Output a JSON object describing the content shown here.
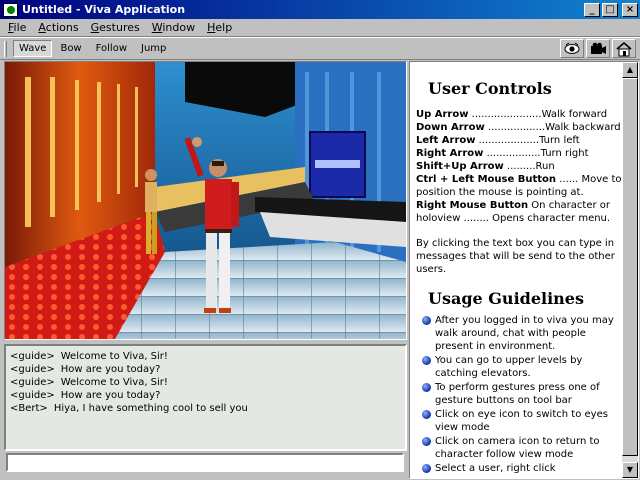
{
  "window": {
    "title": "Untitled - Viva Application",
    "minimize_label": "_",
    "maximize_label": "□",
    "close_label": "×"
  },
  "menu": [
    {
      "first": "F",
      "rest": "ile"
    },
    {
      "first": "A",
      "rest": "ctions"
    },
    {
      "first": "G",
      "rest": "estures"
    },
    {
      "first": "W",
      "rest": "indow"
    },
    {
      "first": "H",
      "rest": "elp"
    }
  ],
  "toolbar": {
    "gestures": [
      "Wave",
      "Bow",
      "Follow",
      "Jump"
    ],
    "pressed_gesture": "Wave",
    "icons": [
      "eye-icon",
      "camera-icon",
      "home-icon"
    ]
  },
  "chat": {
    "lines": [
      {
        "speaker": "<guide>",
        "text": "Welcome to Viva, Sir!"
      },
      {
        "speaker": "<guide>",
        "text": "How are you today?"
      },
      {
        "speaker": "<guide>",
        "text": "Welcome to Viva, Sir!"
      },
      {
        "speaker": "<guide>",
        "text": "How are you today?"
      },
      {
        "speaker": "<Bert>",
        "text": "Hiya, I have something cool to sell you"
      }
    ],
    "input_value": ""
  },
  "help": {
    "controls_title": "User Controls",
    "controls": [
      {
        "key": "Up Arrow",
        "dots": " ......................",
        "action": "Walk forward"
      },
      {
        "key": "Down Arrow",
        "dots": " ..................",
        "action": "Walk backward"
      },
      {
        "key": "Left Arrow",
        "dots": " ...................",
        "action": "Turn left"
      },
      {
        "key": "Right Arrow",
        "dots": " .................",
        "action": "Turn right"
      },
      {
        "key": "Shift+Up Arrow",
        "dots": " .........",
        "action": "Run"
      }
    ],
    "ctrl_left_key": "Ctrl + Left Mouse Button",
    "ctrl_left_text": " ...... Move to position the mouse is pointing at.",
    "right_mouse_key": "Right Mouse Button",
    "right_mouse_text": " On character or holoview ........ Opens character menu.",
    "chat_paragraph": "By clicking the text box you can type in messages that will be send to the other users.",
    "guidelines_title": "Usage Guidelines",
    "guidelines": [
      "After you logged in to viva you may walk around, chat with people present      in environment.",
      "You can go to upper levels by catching elevators.",
      "To perform gestures press one of gesture buttons on tool bar",
      "Click on eye icon to switch to eyes view mode",
      "Click on camera icon to return to character follow view mode",
      "Select a user, right click"
    ]
  },
  "colors": {
    "titlebar_start": "#000080",
    "titlebar_end": "#1084d0",
    "chat_bg": "#e4e8e2",
    "bullet": "#1030a0"
  }
}
